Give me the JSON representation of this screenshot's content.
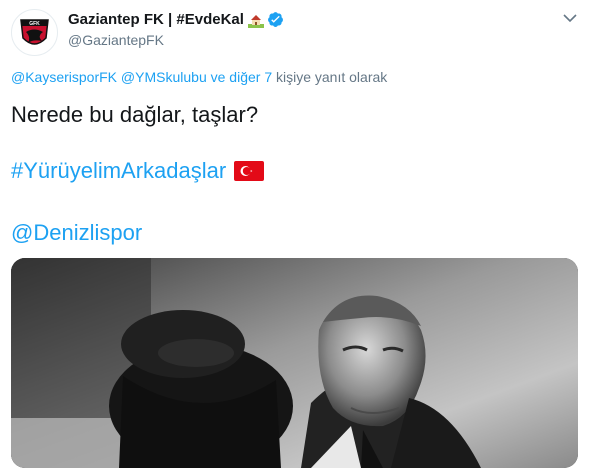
{
  "account": {
    "display_name": "Gaziantep FK | #EvdeKal",
    "handle": "@GaziantepFK",
    "avatar_text": "GFK",
    "verified": true
  },
  "reply": {
    "mention_1": "@KayserisporFK",
    "mention_2": "@YMSkulubu",
    "others_link": "ve diğer 7",
    "suffix": "kişiye yanıt olarak"
  },
  "tweet": {
    "line_1": "Nerede bu dağlar, taşlar?",
    "hashtag": "#YürüyelimArkadaşlar",
    "mention": "@Denizlispor"
  },
  "icons": {
    "house": "house-with-garden-emoji",
    "verified": "verified-badge-icon",
    "flag": "turkey-flag-emoji",
    "more": "chevron-down-icon"
  },
  "colors": {
    "link": "#1da1f2",
    "text": "#14171a",
    "muted": "#657786",
    "flag_red": "#e30a17"
  }
}
